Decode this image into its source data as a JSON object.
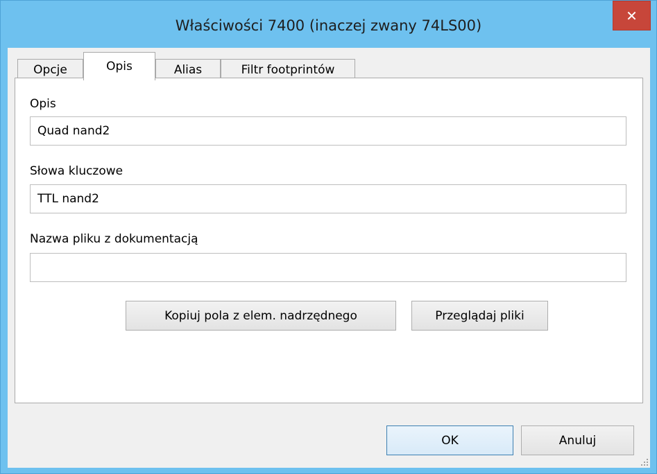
{
  "window": {
    "title": "Właściwości 7400 (inaczej zwany 74LS00)",
    "close_glyph": "✕"
  },
  "tabs": [
    {
      "label": "Opcje"
    },
    {
      "label": "Opis"
    },
    {
      "label": "Alias"
    },
    {
      "label": "Filtr footprintów"
    }
  ],
  "form": {
    "description_label": "Opis",
    "description_value": "Quad nand2",
    "keywords_label": "Słowa kluczowe",
    "keywords_value": "TTL nand2",
    "docfile_label": "Nazwa pliku z dokumentacją",
    "docfile_value": ""
  },
  "actions": {
    "copy_parent_label": "Kopiuj pola z elem. nadrzędnego",
    "browse_label": "Przeglądaj pliki"
  },
  "footer": {
    "ok_label": "OK",
    "cancel_label": "Anuluj"
  }
}
